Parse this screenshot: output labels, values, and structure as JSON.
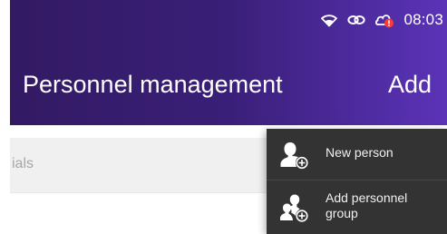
{
  "status_bar": {
    "time": "08:03",
    "icons": [
      "wifi-icon",
      "link-icon",
      "cloud-alert-icon"
    ],
    "alert_color": "#ff3b30"
  },
  "header": {
    "title": "Personnel management",
    "action_label": "Add",
    "gradient_start": "#331a63",
    "gradient_end": "#5b33b8"
  },
  "search": {
    "placeholder": "ials"
  },
  "menu": {
    "background": "#333333",
    "items": [
      {
        "label": "New person",
        "icon": "add-person-icon"
      },
      {
        "label": "Add personnel group",
        "icon": "add-group-icon"
      }
    ]
  }
}
